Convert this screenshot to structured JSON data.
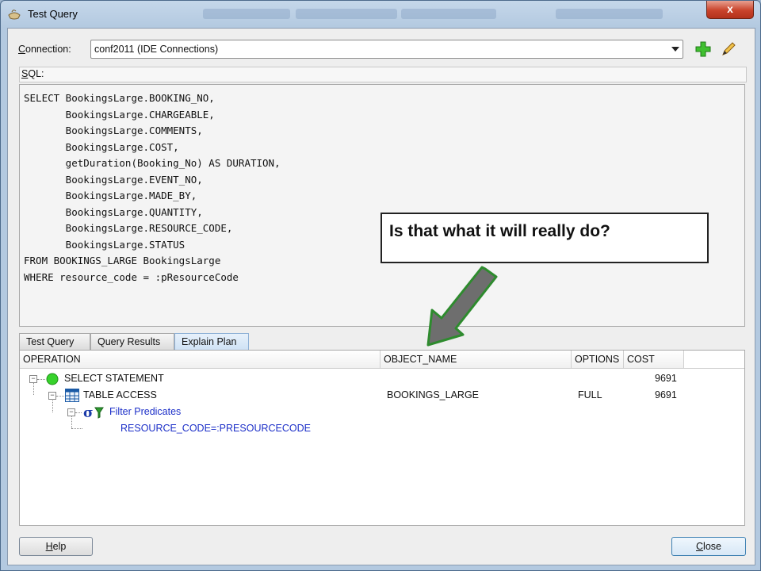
{
  "window": {
    "title": "Test Query",
    "close_glyph": "x"
  },
  "connection": {
    "label": "Connection:",
    "value": "conf2011 (IDE Connections)",
    "add_icon": "green-plus-icon",
    "edit_icon": "pencil-icon"
  },
  "sql": {
    "label": "SQL:",
    "text": "SELECT BookingsLarge.BOOKING_NO,\n       BookingsLarge.CHARGEABLE,\n       BookingsLarge.COMMENTS,\n       BookingsLarge.COST,\n       getDuration(Booking_No) AS DURATION,\n       BookingsLarge.EVENT_NO,\n       BookingsLarge.MADE_BY,\n       BookingsLarge.QUANTITY,\n       BookingsLarge.RESOURCE_CODE,\n       BookingsLarge.STATUS\nFROM BOOKINGS_LARGE BookingsLarge\nWHERE resource_code = :pResourceCode"
  },
  "tabs": [
    "Test Query",
    "Query Results",
    "Explain Plan"
  ],
  "active_tab": "Explain Plan",
  "plan": {
    "columns": [
      "OPERATION",
      "OBJECT_NAME",
      "OPTIONS",
      "COST"
    ],
    "rows": [
      {
        "operation": "SELECT STATEMENT",
        "object_name": "",
        "options": "",
        "cost": "9691",
        "icon": "select-statement-icon"
      },
      {
        "operation": "TABLE ACCESS",
        "object_name": "BOOKINGS_LARGE",
        "options": "FULL",
        "cost": "9691",
        "icon": "table-icon"
      },
      {
        "operation": "Filter Predicates",
        "object_name": "",
        "options": "",
        "cost": "",
        "icon": "filter-predicates-icon"
      },
      {
        "operation": "RESOURCE_CODE=:PRESOURCECODE",
        "object_name": "",
        "options": "",
        "cost": ""
      }
    ]
  },
  "buttons": {
    "help": "Help",
    "close": "Close"
  },
  "annotation": {
    "text": "Is that what it will really do?"
  },
  "colors": {
    "accent_arrow": "#6e6e6e",
    "arrow_border": "#2e8b2e",
    "predicate_text": "#1c2fc8"
  }
}
